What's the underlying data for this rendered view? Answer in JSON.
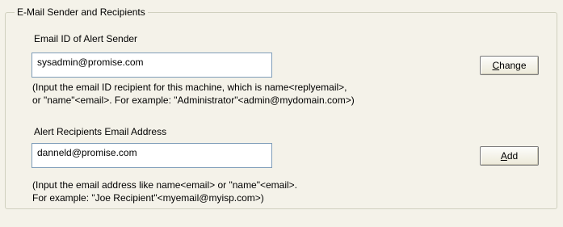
{
  "group": {
    "title": "E-Mail Sender and Recipients"
  },
  "sender": {
    "label": "Email ID of Alert Sender",
    "value": "sysadmin@promise.com",
    "button_mnemonic": "C",
    "button_rest": "hange",
    "hint_line1": "(Input the email ID recipient for this machine, which is name<replyemail>,",
    "hint_line2": "or \"name\"<email>. For example: \"Administrator\"<admin@mydomain.com>)"
  },
  "recipients": {
    "label": "Alert Recipients Email Address",
    "value": "danneld@promise.com",
    "button_mnemonic": "A",
    "button_rest": "dd",
    "hint_line1": "(Input the email address like name<email> or \"name\"<email>.",
    "hint_line2": "For example: \"Joe Recipient\"<myemail@myisp.com>)"
  }
}
